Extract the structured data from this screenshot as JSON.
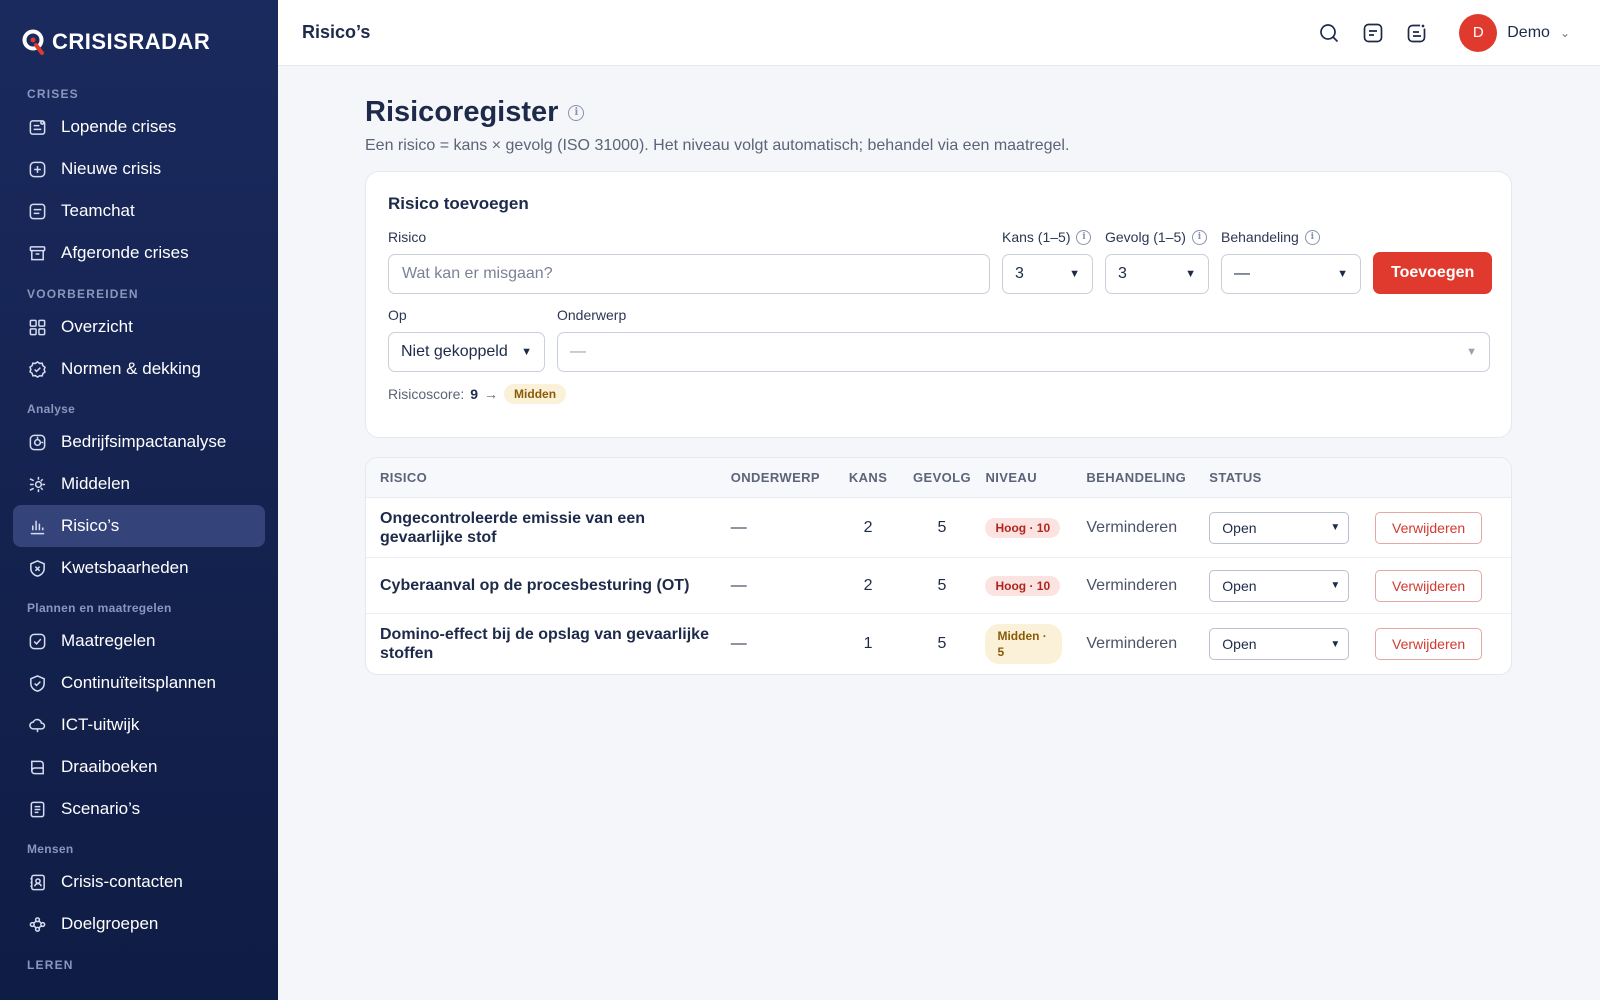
{
  "app": {
    "logo": "CRISISRADAR",
    "brand_color": "#e03a2e"
  },
  "sidebar": {
    "sections": [
      {
        "title": "CRISES",
        "items": [
          {
            "label": "Lopende crises",
            "icon": "running-crises-icon"
          },
          {
            "label": "Nieuwe crisis",
            "icon": "plus-square-icon"
          },
          {
            "label": "Teamchat",
            "icon": "chat-icon"
          },
          {
            "label": "Afgeronde crises",
            "icon": "archive-icon"
          }
        ]
      },
      {
        "title": "VOORBEREIDEN",
        "items": [
          {
            "label": "Overzicht",
            "icon": "grid-icon"
          },
          {
            "label": "Normen & dekking",
            "icon": "badge-check-icon"
          }
        ]
      },
      {
        "title": "Analyse",
        "items": [
          {
            "label": "Bedrijfsimpactanalyse",
            "icon": "impact-icon"
          },
          {
            "label": "Middelen",
            "icon": "resources-icon"
          },
          {
            "label": "Risico’s",
            "icon": "bar-chart-icon"
          },
          {
            "label": "Kwetsbaarheden",
            "icon": "shield-x-icon"
          }
        ]
      },
      {
        "title": "Plannen en maatregelen",
        "items": [
          {
            "label": "Maatregelen",
            "icon": "check-square-icon"
          },
          {
            "label": "Continuïteitsplannen",
            "icon": "shield-check-icon"
          },
          {
            "label": "ICT-uitwijk",
            "icon": "cloud-icon"
          },
          {
            "label": "Draaiboeken",
            "icon": "book-icon"
          },
          {
            "label": "Scenario’s",
            "icon": "document-icon"
          }
        ]
      },
      {
        "title": "Mensen",
        "items": [
          {
            "label": "Crisis-contacten",
            "icon": "contact-icon"
          },
          {
            "label": "Doelgroepen",
            "icon": "people-icon"
          }
        ]
      },
      {
        "title": "LEREN",
        "items": []
      }
    ]
  },
  "topbar": {
    "title": "Risico’s",
    "user": {
      "initial": "D",
      "name": "Demo"
    }
  },
  "page": {
    "title": "Risicoregister",
    "subtitle": "Een risico = kans × gevolg (ISO 31000). Het niveau volgt automatisch; behandel via een maatregel."
  },
  "form": {
    "heading": "Risico toevoegen",
    "risk_label": "Risico",
    "risk_placeholder": "Wat kan er misgaan?",
    "kans_label": "Kans (1–5)",
    "kans_value": "3",
    "gevolg_label": "Gevolg (1–5)",
    "gevolg_value": "3",
    "behandeling_label": "Behandeling",
    "behandeling_value": "—",
    "add_button": "Toevoegen",
    "op_label": "Op",
    "op_value": "Niet gekoppeld",
    "onderwerp_label": "Onderwerp",
    "onderwerp_value": "—",
    "score_label": "Risicoscore:",
    "score_value": "9",
    "score_arrow": "→",
    "score_level": "Midden"
  },
  "table": {
    "headers": [
      "RISICO",
      "ONDERWERP",
      "KANS",
      "GEVOLG",
      "NIVEAU",
      "BEHANDELING",
      "STATUS"
    ],
    "rows": [
      {
        "risico": "Ongecontroleerde emissie van een gevaarlijke stof",
        "onderwerp": "—",
        "kans": "2",
        "gevolg": "5",
        "niveau": "Hoog · 10",
        "niveau_type": "high",
        "behandeling": "Verminderen",
        "status": "Open",
        "action": "Verwijderen"
      },
      {
        "risico": "Cyberaanval op de procesbesturing (OT)",
        "onderwerp": "—",
        "kans": "2",
        "gevolg": "5",
        "niveau": "Hoog · 10",
        "niveau_type": "high",
        "behandeling": "Verminderen",
        "status": "Open",
        "action": "Verwijderen"
      },
      {
        "risico": "Domino-effect bij de opslag van gevaarlijke stoffen",
        "onderwerp": "—",
        "kans": "1",
        "gevolg": "5",
        "niveau": "Midden · 5",
        "niveau_type": "mid",
        "behandeling": "Verminderen",
        "status": "Open",
        "action": "Verwijderen"
      }
    ]
  }
}
